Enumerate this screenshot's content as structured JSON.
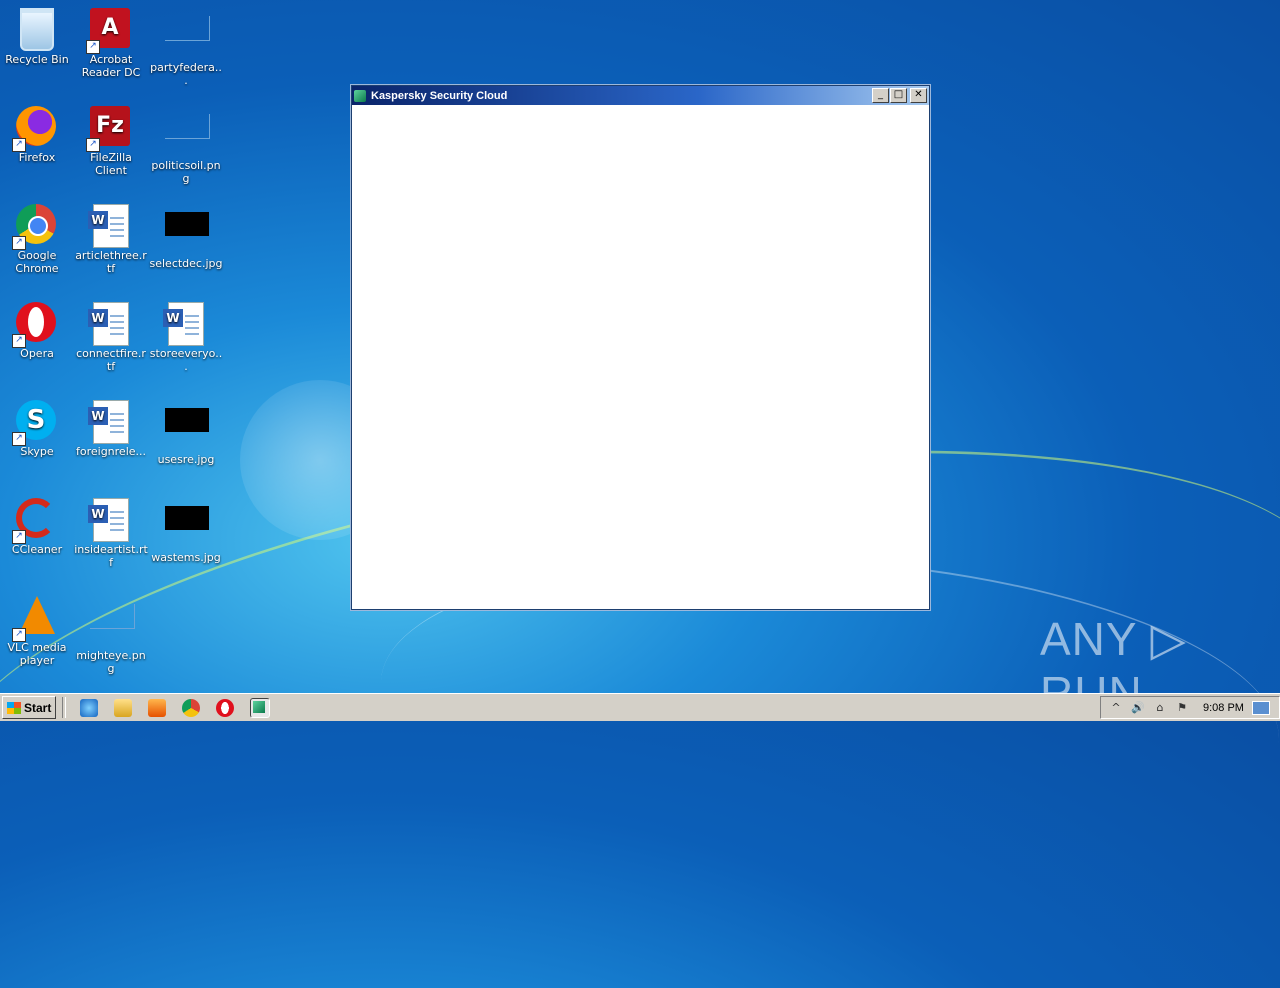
{
  "desktop": {
    "icons": [
      {
        "label": "Recycle Bin",
        "icon": "recycle-bin-icon"
      },
      {
        "label": "Acrobat Reader DC",
        "icon": "acrobat-icon"
      },
      {
        "label": "partyfedera...",
        "icon": "image-file-icon"
      },
      {
        "label": "Firefox",
        "icon": "firefox-icon"
      },
      {
        "label": "FileZilla Client",
        "icon": "filezilla-icon"
      },
      {
        "label": "politicsoil.png",
        "icon": "image-file-icon"
      },
      {
        "label": "Google Chrome",
        "icon": "chrome-icon"
      },
      {
        "label": "articlethree.rtf",
        "icon": "word-doc-icon"
      },
      {
        "label": "selectdec.jpg",
        "icon": "image-file-icon"
      },
      {
        "label": "Opera",
        "icon": "opera-icon"
      },
      {
        "label": "connectfire.rtf",
        "icon": "word-doc-icon"
      },
      {
        "label": "storeeveryo...",
        "icon": "word-doc-icon"
      },
      {
        "label": "Skype",
        "icon": "skype-icon"
      },
      {
        "label": "foreignrele...",
        "icon": "word-doc-icon"
      },
      {
        "label": "usesre.jpg",
        "icon": "image-file-icon"
      },
      {
        "label": "CCleaner",
        "icon": "ccleaner-icon"
      },
      {
        "label": "insideartist.rtf",
        "icon": "word-doc-icon"
      },
      {
        "label": "wastems.jpg",
        "icon": "image-file-icon"
      },
      {
        "label": "VLC media player",
        "icon": "vlc-icon"
      },
      {
        "label": "mighteye.png",
        "icon": "image-file-icon"
      }
    ]
  },
  "window": {
    "title": "Kaspersky Security Cloud",
    "minimize": "_",
    "maximize": "□",
    "close": "✕"
  },
  "watermark": "ANY ▷ RUN",
  "taskbar": {
    "start_label": "Start",
    "quick_launch": [
      "ie-icon",
      "explorer-icon",
      "media-player-icon",
      "chrome-icon",
      "opera-icon",
      "kaspersky-icon"
    ],
    "tray_symbols": [
      "^",
      "🔊",
      "⌂",
      "⚑"
    ],
    "clock": "9:08 PM"
  },
  "colors": {
    "title_bar_start": "#0a246a",
    "title_bar_end": "#a6caf0",
    "taskbar": "#d4d0c8",
    "desktop_blue": "#0b5fb8"
  }
}
